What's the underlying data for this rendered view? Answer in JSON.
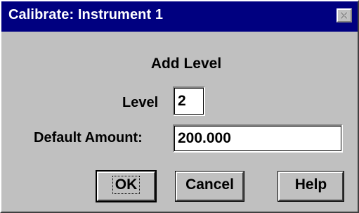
{
  "window": {
    "title": "Calibrate: Instrument 1",
    "close_icon": "close-x-icon"
  },
  "dialog": {
    "heading": "Add Level",
    "level_label": "Level",
    "level_value": "2",
    "amount_label": "Default Amount:",
    "amount_value": "200.000"
  },
  "buttons": {
    "ok_label": "OK",
    "cancel_label": "Cancel",
    "help_label": "Help"
  },
  "colors": {
    "titlebar": "#000080",
    "window_bg": "#c0c0c0",
    "field_bg": "#ffffff"
  }
}
